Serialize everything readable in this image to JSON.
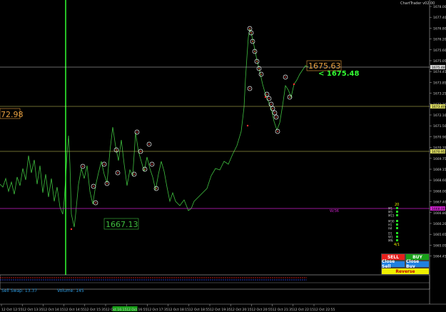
{
  "app": {
    "brand": "ChartTrader v02.00"
  },
  "price_axis": {
    "labels": [
      "1678.00",
      "1677.40",
      "1676.80",
      "1676.20",
      "1675.60",
      "1675.05",
      "1674.45",
      "1673.85",
      "1673.25",
      "1672.70",
      "1672.10",
      "1671.50",
      "1670.90",
      "1670.35",
      "1669.75",
      "1669.15",
      "1668.60",
      "1668.00",
      "1667.40",
      "1666.80",
      "1666.20",
      "1665.65",
      "1665.05",
      "1664.45"
    ],
    "highlight_labels": [
      "1675.48",
      "1673.40",
      "1670.95",
      "1668.00"
    ]
  },
  "time_axis": {
    "labels": [
      "12 Oct 12:55",
      "12 Oct 13:35",
      "12 Oct 14:15",
      "12 Oct 14:55",
      "12 Oct 15:35",
      "12 Oct 16:15",
      "12 Oct 16:55",
      "12 Oct 17:35",
      "12 Oct 18:15",
      "12 Oct 18:55",
      "12 Oct 19:35",
      "12 Oct 20:15",
      "12 Oct 20:55",
      "12 Oct 21:35",
      "12 Oct 22:15",
      "12 Oct 22:55"
    ],
    "highlight": "12 Oct 14:55"
  },
  "levels": {
    "upper_label": "1675.63",
    "left_label": "72.98",
    "bid_label": "< 1675.48",
    "lower_label": "1667.13",
    "magenta_label": "W/36"
  },
  "timeframes": {
    "top_value": "20",
    "items": [
      "M1",
      "M5",
      "M15",
      "M30",
      "H1",
      "H4",
      "D1",
      "W1",
      "MN"
    ],
    "bottom_value": "4/1"
  },
  "buttons": {
    "sell": "SELL",
    "buy": "BUY",
    "close_sell": "Close Sell",
    "close_buy": "Close Buy",
    "reverse": "Reverse"
  },
  "status": {
    "sell_swap": "Sell Swap: 13.37",
    "volume": "Volume: 145"
  },
  "colors": {
    "price_line": "#3fbf3f",
    "orange": "#e8a040",
    "bid": "#33ff33",
    "magenta": "#cc22cc",
    "sell_btn": "#e8201c",
    "buy_btn": "#18a018",
    "close_btn": "#2080e0",
    "reverse_btn": "#f0f000"
  }
}
